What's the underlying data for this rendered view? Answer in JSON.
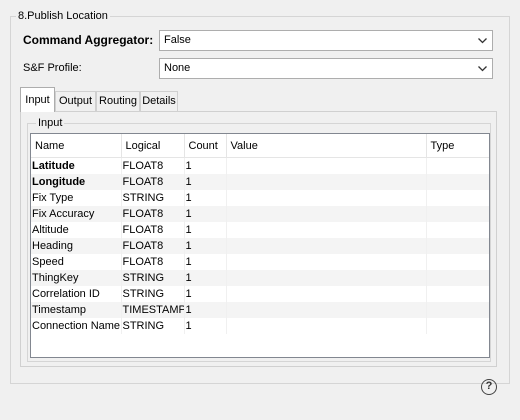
{
  "section": {
    "title": "8.Publish Location"
  },
  "command_aggregator": {
    "label": "Command Aggregator:",
    "value": "False"
  },
  "sf_profile": {
    "label": "S&F Profile:",
    "value": "None"
  },
  "tabs": [
    {
      "label": "Input",
      "active": true
    },
    {
      "label": "Output",
      "active": false
    },
    {
      "label": "Routing",
      "active": false
    },
    {
      "label": "Details",
      "active": false
    }
  ],
  "input_group": {
    "title": "Input"
  },
  "table": {
    "headers": [
      "Name",
      "Logical",
      "Count",
      "Value",
      "Type"
    ],
    "rows": [
      {
        "name": "Latitude",
        "logical": "FLOAT8",
        "count": "1",
        "value": "",
        "type": "",
        "bold": true
      },
      {
        "name": "Longitude",
        "logical": "FLOAT8",
        "count": "1",
        "value": "",
        "type": "",
        "bold": true
      },
      {
        "name": "Fix Type",
        "logical": "STRING",
        "count": "1",
        "value": "",
        "type": ""
      },
      {
        "name": "Fix Accuracy",
        "logical": "FLOAT8",
        "count": "1",
        "value": "",
        "type": ""
      },
      {
        "name": "Altitude",
        "logical": "FLOAT8",
        "count": "1",
        "value": "",
        "type": ""
      },
      {
        "name": "Heading",
        "logical": "FLOAT8",
        "count": "1",
        "value": "",
        "type": ""
      },
      {
        "name": "Speed",
        "logical": "FLOAT8",
        "count": "1",
        "value": "",
        "type": ""
      },
      {
        "name": "ThingKey",
        "logical": "STRING",
        "count": "1",
        "value": "",
        "type": ""
      },
      {
        "name": "Correlation ID",
        "logical": "STRING",
        "count": "1",
        "value": "",
        "type": ""
      },
      {
        "name": "Timestamp",
        "logical": "TIMESTAMP",
        "count": "1",
        "value": "",
        "type": ""
      },
      {
        "name": "Connection Name",
        "logical": "STRING",
        "count": "1",
        "value": "",
        "type": ""
      }
    ]
  },
  "help": {
    "icon": "help-icon",
    "glyph": "?"
  }
}
